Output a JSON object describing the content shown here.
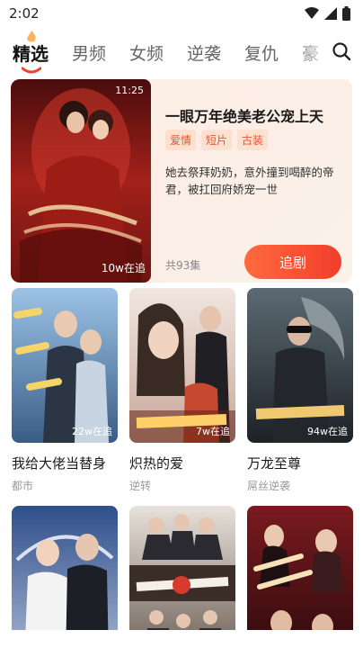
{
  "status": {
    "time": "2:02"
  },
  "tabs": [
    "精选",
    "男频",
    "女频",
    "逆袭",
    "复仇",
    "豪"
  ],
  "featured": {
    "title": "一眼万年绝美老公宠上天",
    "tags": [
      "爱情",
      "短片",
      "古装"
    ],
    "description": "她去祭拜奶奶，意外撞到喝醉的帝君，被扛回府娇宠一世",
    "episodes": "共93集",
    "duration": "11:25",
    "views": "10w在追",
    "follow_label": "追剧"
  },
  "cards": [
    {
      "name": "我给大佬当替身",
      "genre": "都市",
      "count": "22w在追"
    },
    {
      "name": "炽热的爱",
      "genre": "逆转",
      "count": "7w在追"
    },
    {
      "name": "万龙至尊",
      "genre": "屌丝逆袭",
      "count": "94w在追"
    },
    {
      "name": "",
      "genre": "",
      "count": ""
    },
    {
      "name": "",
      "genre": "",
      "count": ""
    },
    {
      "name": "",
      "genre": "",
      "count": ""
    }
  ],
  "colors": {
    "accent": "#f23e2a",
    "tag_bg": "#fde0cf",
    "tag_text": "#e2582f"
  }
}
